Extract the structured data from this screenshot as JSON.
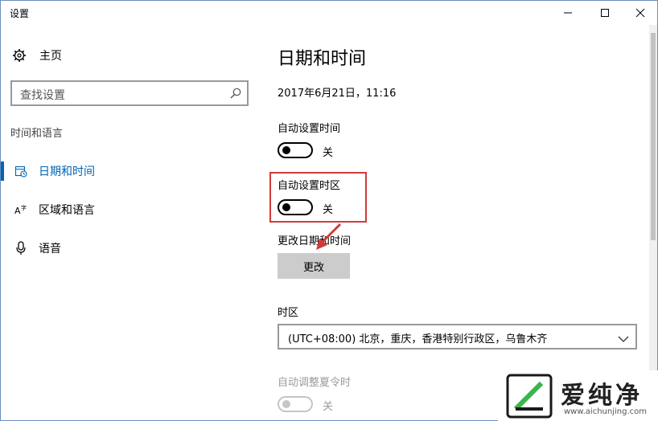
{
  "window": {
    "title": "设置"
  },
  "sidebar": {
    "home_label": "主页",
    "search": {
      "placeholder": "查找设置"
    },
    "section_label": "时间和语言",
    "items": [
      {
        "label": "日期和时间",
        "icon": "calendar-clock-icon",
        "active": true
      },
      {
        "label": "区域和语言",
        "icon": "region-language-icon",
        "active": false
      },
      {
        "label": "语音",
        "icon": "microphone-icon",
        "active": false
      }
    ]
  },
  "main": {
    "title": "日期和时间",
    "current_datetime": "2017年6月21日，11:16",
    "auto_time": {
      "label": "自动设置时间",
      "state": "关"
    },
    "auto_timezone": {
      "label": "自动设置时区",
      "state": "关"
    },
    "change_datetime": {
      "label": "更改日期和时间",
      "button": "更改"
    },
    "timezone": {
      "label": "时区",
      "value": "(UTC+08:00) 北京，重庆，香港特别行政区，乌鲁木齐"
    },
    "dst": {
      "label": "自动调整夏令时",
      "state": "关"
    }
  },
  "watermark": {
    "text": "爱纯净",
    "url": "www.aichunjing.com"
  },
  "colors": {
    "accent": "#0063b1",
    "highlight": "#d23a3a",
    "button_bg": "#cccccc"
  }
}
